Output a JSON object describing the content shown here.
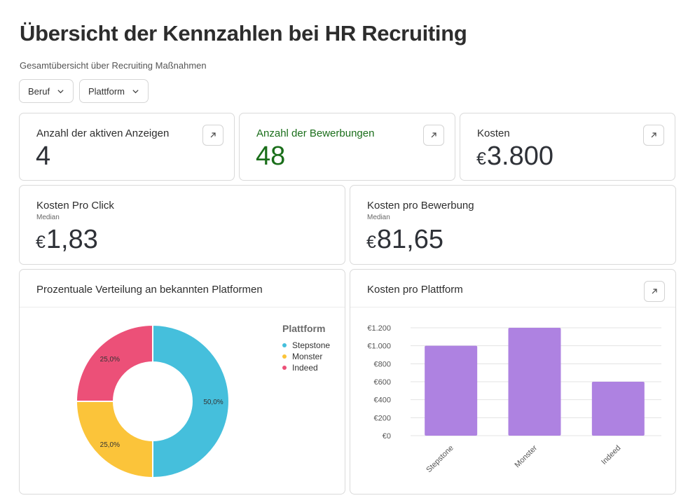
{
  "header": {
    "title": "Übersicht der Kennzahlen bei HR Recruiting",
    "subtitle": "Gesamtübersicht über Recruiting Maßnahmen"
  },
  "filters": [
    {
      "label": "Beruf"
    },
    {
      "label": "Plattform"
    }
  ],
  "kpis": {
    "active_ads": {
      "label": "Anzahl der aktiven Anzeigen",
      "value": "4"
    },
    "applications": {
      "label": "Anzahl der Bewerbungen",
      "value": "48"
    },
    "costs": {
      "label": "Kosten",
      "currency": "€",
      "value": "3.800"
    },
    "cost_per_click": {
      "label": "Kosten Pro Click",
      "sub": "Median",
      "currency": "€",
      "value": "1,83"
    },
    "cost_per_application": {
      "label": "Kosten pro Bewerbung",
      "sub": "Median",
      "currency": "€",
      "value": "81,65"
    }
  },
  "colors": {
    "green": "#1a6e1a",
    "stepstone": "#45bfdc",
    "monster": "#fbc43a",
    "indeed": "#ec5078",
    "bar": "#ae82e1"
  },
  "chart_data": [
    {
      "type": "pie",
      "title": "Prozentuale Verteilung an bekannten Platformen",
      "legend_title": "Plattform",
      "legend_position": "right",
      "categories": [
        "Stepstone",
        "Monster",
        "Indeed"
      ],
      "values": [
        50.0,
        25.0,
        25.0
      ],
      "labels": [
        "50,0%",
        "25,0%",
        "25,0%"
      ]
    },
    {
      "type": "bar",
      "title": "Kosten pro Plattform",
      "categories": [
        "Stepstone",
        "Monster",
        "Indeed"
      ],
      "values": [
        1000,
        1200,
        600
      ],
      "ylim": [
        0,
        1200
      ],
      "yticks": [
        0,
        200,
        400,
        600,
        800,
        1000,
        1200
      ],
      "ytick_labels": [
        "€0",
        "€200",
        "€400",
        "€600",
        "€800",
        "€1.000",
        "€1.200"
      ],
      "grid": true
    }
  ]
}
